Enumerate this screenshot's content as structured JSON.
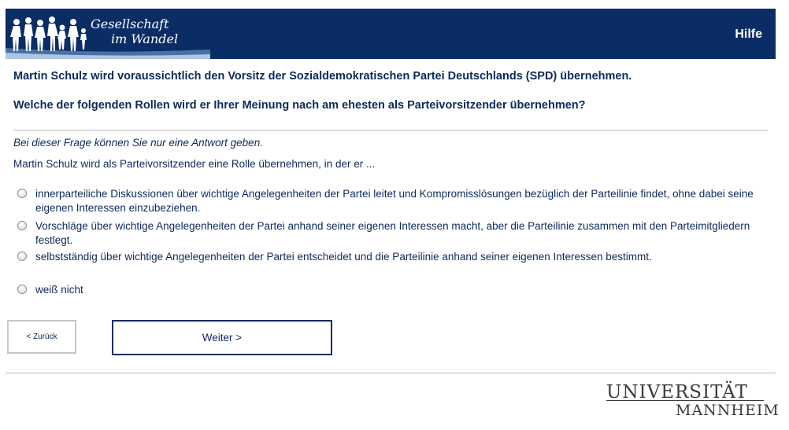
{
  "header": {
    "logo_line1": "Gesellschaft",
    "logo_line2": "im Wandel",
    "help_label": "Hilfe",
    "background_color": "#0b2d65"
  },
  "question": {
    "statement": "Martin Schulz wird voraussichtlich den Vorsitz der Sozialdemokratischen Partei Deutschlands (SPD) übernehmen.",
    "prompt": "Welche der folgenden Rollen wird er Ihrer Meinung nach am ehesten als Parteivorsitzender übernehmen?",
    "hint": "Bei dieser Frage können Sie nur eine Antwort geben.",
    "intro": "Martin Schulz wird als Parteivorsitzender eine Rolle übernehmen, in der er ..."
  },
  "options": [
    {
      "label": "innerparteiliche Diskussionen über wichtige Angelegenheiten der Partei leitet und Kompromisslösungen bezüglich der Parteilinie findet, ohne dabei seine eigenen Interessen einzubeziehen.",
      "selected": false
    },
    {
      "label": "Vorschläge über wichtige Angelegenheiten der Partei anhand seiner eigenen Interessen macht, aber die Parteilinie zusammen mit den Parteimitgliedern festlegt.",
      "selected": false
    },
    {
      "label": "selbstständig über wichtige Angelegenheiten der Partei entscheidet und die Parteilinie anhand seiner eigenen Interessen bestimmt.",
      "selected": false
    },
    {
      "label": "weiß nicht",
      "selected": false
    }
  ],
  "navigation": {
    "back_label": "< Zurück",
    "next_label": "Weiter >"
  },
  "footer": {
    "university_line1": "UNIVERSITÄT",
    "university_line2": "MANNHEIM"
  }
}
